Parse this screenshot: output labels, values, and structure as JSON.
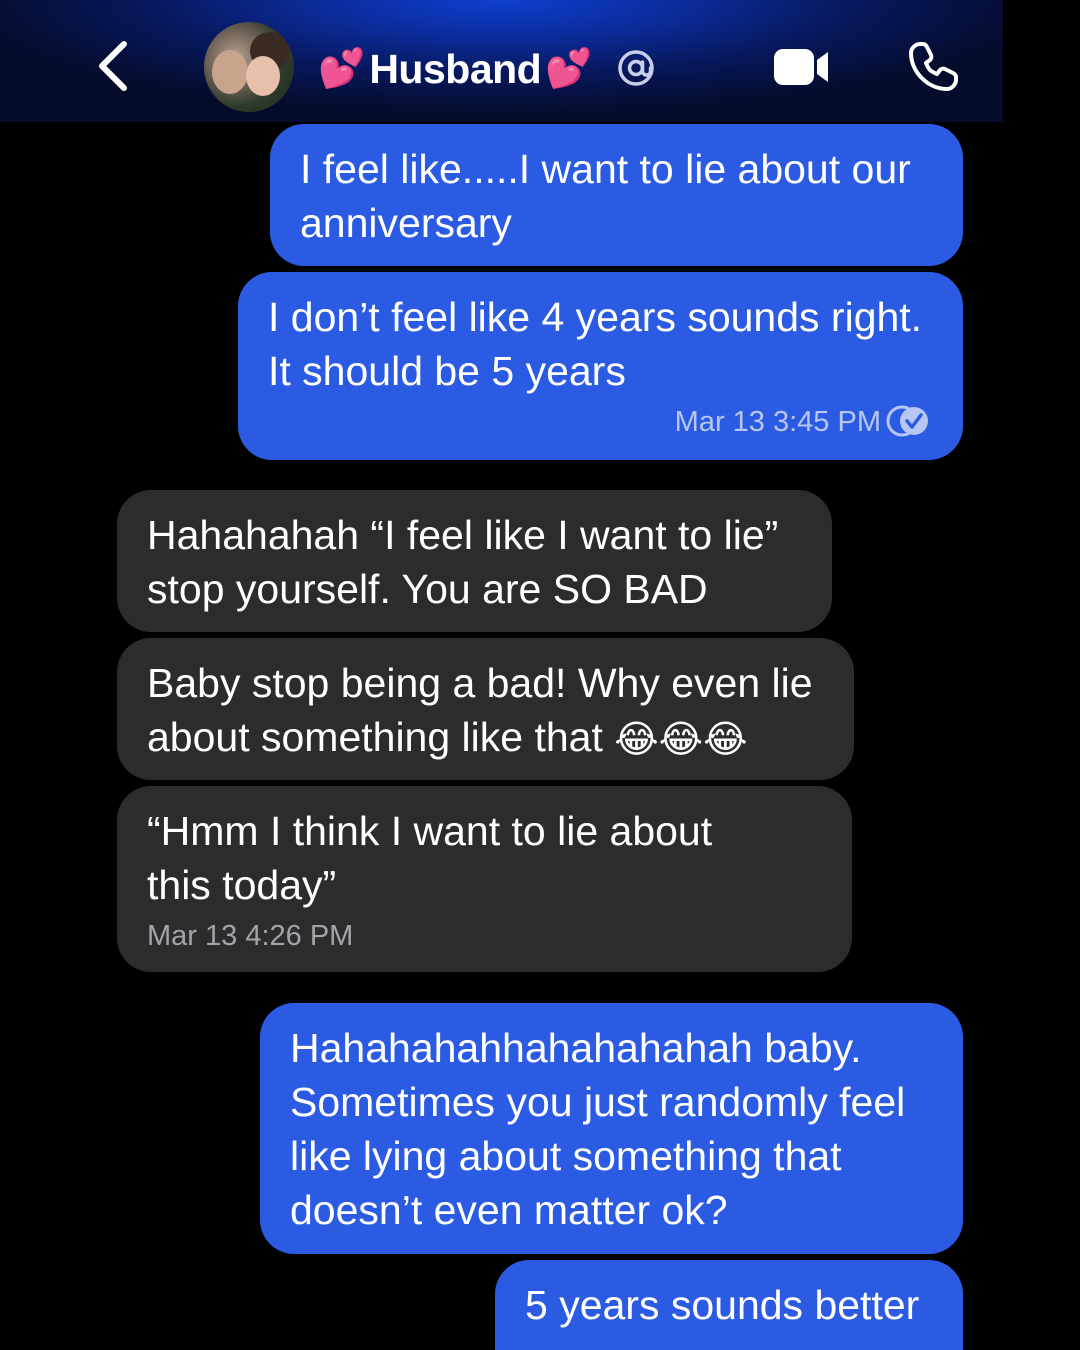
{
  "header": {
    "contact_name": "Husband",
    "heart_emoji": "💕"
  },
  "messages": [
    {
      "side": "sent",
      "lines": [
        "I feel like.....I want to lie about our",
        "anniversary"
      ]
    },
    {
      "side": "sent",
      "lines": [
        "I don’t feel like 4 years sounds right.",
        "It should be 5 years"
      ],
      "timestamp": "Mar 13 3:45 PM"
    },
    {
      "side": "received",
      "lines": [
        "Hahahahah “I feel like I want to lie”",
        "stop yourself. You are SO BAD"
      ]
    },
    {
      "side": "received",
      "lines": [
        "Baby stop being a bad! Why even lie",
        "about something like that"
      ],
      "emoji": "😂😂😂"
    },
    {
      "side": "received",
      "lines": [
        "“Hmm I think I want to lie about",
        "this today”"
      ],
      "timestamp": "Mar 13 4:26 PM"
    },
    {
      "side": "sent",
      "lines": [
        "Hahahahahhahahahahah baby.",
        "Sometimes you just randomly feel",
        "like lying about something that",
        "doesn’t even matter ok?"
      ]
    },
    {
      "side": "sent",
      "lines": [
        "5 years sounds better"
      ]
    }
  ],
  "colors": {
    "sent_bubble": "#2b5be3",
    "received_bubble": "#2c2c2e",
    "header_accent": "#0f3fd0",
    "heart": "#ff4fa3"
  },
  "icons": [
    "back-arrow-icon",
    "at-mention-icon",
    "video-call-icon",
    "phone-call-icon",
    "read-receipt-check-icon"
  ]
}
